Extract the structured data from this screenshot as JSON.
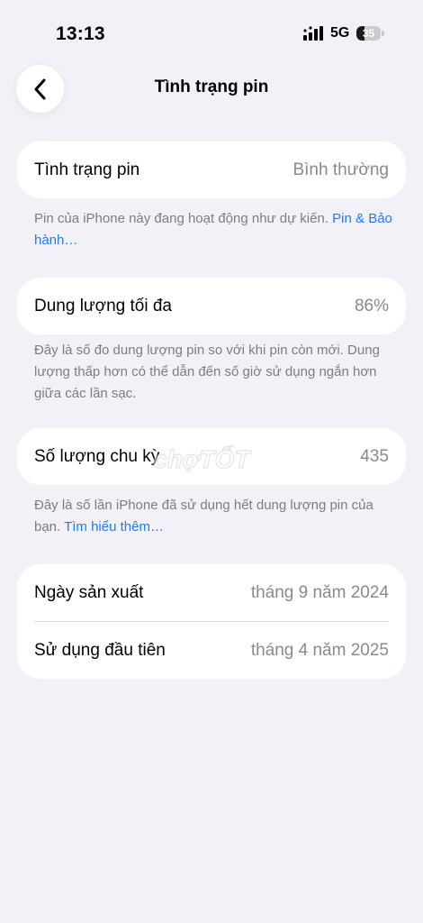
{
  "status_bar": {
    "time": "13:13",
    "network": "5G",
    "battery_level": "35",
    "icons": [
      "signal-bars-icon",
      "battery-icon"
    ]
  },
  "nav": {
    "back_icon": "chevron-left-icon",
    "title": "Tình trạng pin"
  },
  "battery_health": {
    "label": "Tình trạng pin",
    "value": "Bình thường",
    "note_text": "Pin của iPhone này đang hoạt động như dự kiến. ",
    "note_link": "Pin & Bảo hành…"
  },
  "max_capacity": {
    "label": "Dung lượng tối đa",
    "value": "86%",
    "note_text": "Đây là số đo dung lượng pin so với khi pin còn mới. Dung lượng thấp hơn có thể dẫn đến số giờ sử dụng ngắn hơn giữa các lần sạc."
  },
  "cycle_count": {
    "label": "Số lượng chu kỳ",
    "value": "435",
    "note_text": "Đây là số lần iPhone đã sử dụng hết dung lượng pin của bạn. ",
    "note_link": "Tìm hiểu thêm…"
  },
  "dates": {
    "manufacture_label": "Ngày sản xuất",
    "manufacture_value": "tháng 9 năm 2024",
    "first_use_label": "Sử dụng đầu tiên",
    "first_use_value": "tháng 4 năm 2025"
  },
  "watermark": {
    "text": "chợTỐT"
  },
  "colors": {
    "background": "#f2f1f7",
    "card": "#ffffff",
    "link": "#1e7cf2",
    "secondary_text": "#8a8a8e"
  }
}
